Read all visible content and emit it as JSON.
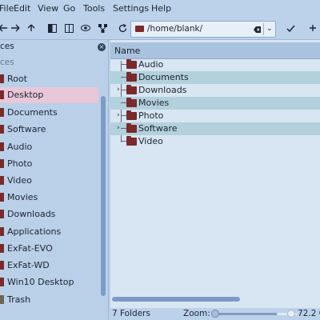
{
  "menubar": {
    "items": [
      "File",
      "Edit",
      "View",
      "Go",
      "Tools",
      "Settings",
      "Help"
    ]
  },
  "toolbar": {
    "icons": [
      "back-icon",
      "forward-icon",
      "up-icon",
      "split-icon",
      "columns-icon",
      "eye-icon",
      "network-icon",
      "reload-icon",
      "confirm-icon",
      "add-icon"
    ],
    "address": "/home/blank/"
  },
  "places": {
    "title": "ces",
    "sub": "ces",
    "items": [
      {
        "label": "Root",
        "icon": "folder-icon",
        "selected": false
      },
      {
        "label": "Desktop",
        "icon": "folder-icon",
        "selected": true
      },
      {
        "label": "Documents",
        "icon": "folder-icon",
        "selected": false
      },
      {
        "label": "Software",
        "icon": "folder-icon",
        "selected": false
      },
      {
        "label": "Audio",
        "icon": "folder-icon",
        "selected": false
      },
      {
        "label": "Photo",
        "icon": "folder-icon",
        "selected": false
      },
      {
        "label": "Video",
        "icon": "folder-icon",
        "selected": false
      },
      {
        "label": "Movies",
        "icon": "folder-icon",
        "selected": false
      },
      {
        "label": "Downloads",
        "icon": "folder-icon",
        "selected": false
      },
      {
        "label": "Applications",
        "icon": "folder-icon",
        "selected": false
      },
      {
        "label": "ExFat-EVO",
        "icon": "drive-icon",
        "selected": false
      },
      {
        "label": "ExFat-WD",
        "icon": "drive-icon",
        "selected": false
      },
      {
        "label": "Win10 Desktop",
        "icon": "drive-icon",
        "selected": false
      },
      {
        "label": "Trash",
        "icon": "trash-icon",
        "selected": false
      }
    ]
  },
  "files": {
    "column_name": "Name",
    "rows": [
      {
        "name": "Audio",
        "expandable": false,
        "alt": false
      },
      {
        "name": "Documents",
        "expandable": false,
        "alt": true
      },
      {
        "name": "Downloads",
        "expandable": true,
        "alt": false
      },
      {
        "name": "Movies",
        "expandable": false,
        "alt": true
      },
      {
        "name": "Photo",
        "expandable": true,
        "alt": false
      },
      {
        "name": "Software",
        "expandable": true,
        "alt": true
      },
      {
        "name": "Video",
        "expandable": false,
        "alt": false
      }
    ]
  },
  "status": {
    "count": "7 Folders",
    "zoom_label": "Zoom:",
    "free_space": "72.2 G"
  },
  "colors": {
    "selection": "#e8c7d9",
    "folder": "#7a2a2a",
    "alt_row": "#b3d1dc"
  }
}
